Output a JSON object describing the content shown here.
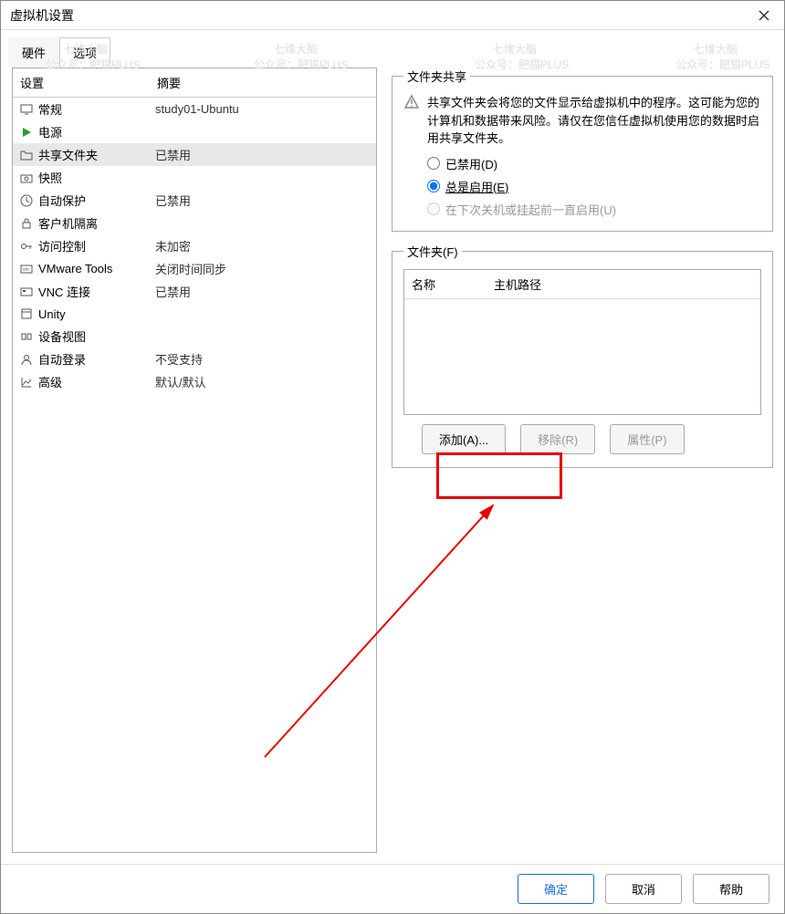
{
  "window": {
    "title": "虚拟机设置"
  },
  "tabs": {
    "hardware": "硬件",
    "options": "选项"
  },
  "settings_table": {
    "col_setting": "设置",
    "col_summary": "摘要",
    "rows": [
      {
        "label": "常规",
        "summary": "study01-Ubuntu",
        "icon": "monitor"
      },
      {
        "label": "电源",
        "summary": "",
        "icon": "play"
      },
      {
        "label": "共享文件夹",
        "summary": "已禁用",
        "icon": "folder",
        "selected": true
      },
      {
        "label": "快照",
        "summary": "",
        "icon": "camera"
      },
      {
        "label": "自动保护",
        "summary": "已禁用",
        "icon": "clock"
      },
      {
        "label": "客户机隔离",
        "summary": "",
        "icon": "lock"
      },
      {
        "label": "访问控制",
        "summary": "未加密",
        "icon": "key"
      },
      {
        "label": "VMware Tools",
        "summary": "关闭时间同步",
        "icon": "vm"
      },
      {
        "label": "VNC 连接",
        "summary": "已禁用",
        "icon": "vnc"
      },
      {
        "label": "Unity",
        "summary": "",
        "icon": "window"
      },
      {
        "label": "设备视图",
        "summary": "",
        "icon": "device"
      },
      {
        "label": "自动登录",
        "summary": "不受支持",
        "icon": "user"
      },
      {
        "label": "高级",
        "summary": "默认/默认",
        "icon": "chart"
      }
    ]
  },
  "sharing": {
    "legend": "文件夹共享",
    "warning": "共享文件夹会将您的文件显示给虚拟机中的程序。这可能为您的计算机和数据带来风险。请仅在您信任虚拟机使用您的数据时启用共享文件夹。",
    "radio_disabled": "已禁用(D)",
    "radio_always": "总是启用(E)",
    "radio_next": "在下次关机或挂起前一直启用(U)"
  },
  "folders": {
    "legend": "文件夹(F)",
    "col_name": "名称",
    "col_path": "主机路径",
    "btn_add": "添加(A)...",
    "btn_remove": "移除(R)",
    "btn_props": "属性(P)"
  },
  "buttons": {
    "ok": "确定",
    "cancel": "取消",
    "help": "帮助"
  },
  "watermarks": {
    "w1": "七维大脑",
    "w2": "公众号：肥猫PLUS"
  }
}
